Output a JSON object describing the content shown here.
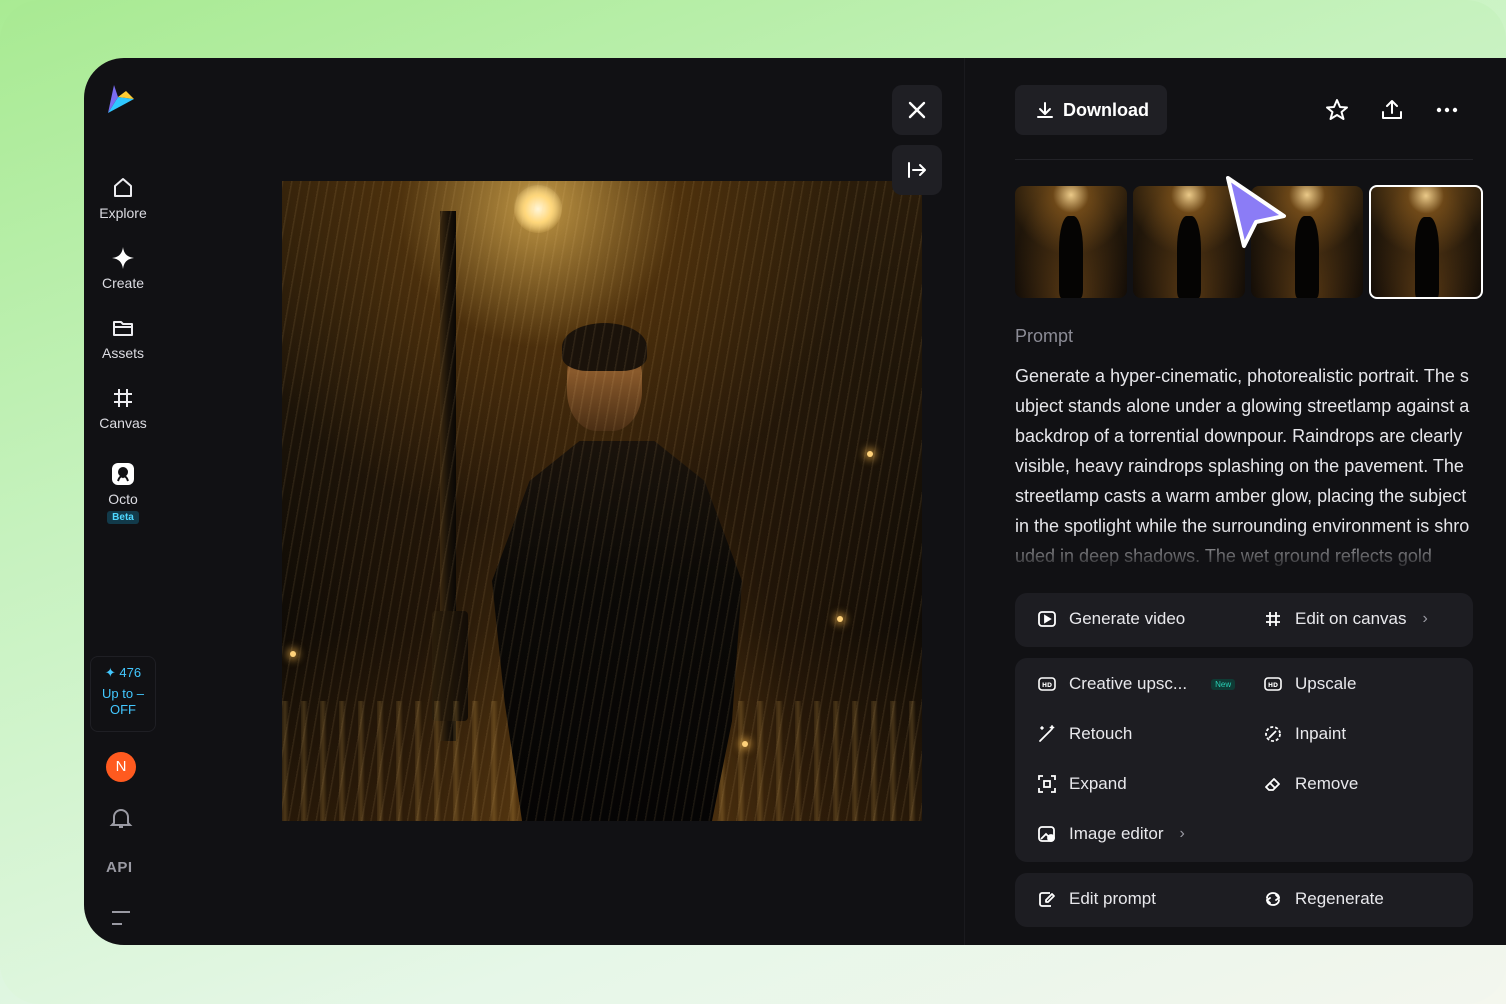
{
  "sidebar": {
    "items": [
      {
        "label": "Explore",
        "icon": "home-icon"
      },
      {
        "label": "Create",
        "icon": "sparkle-icon"
      },
      {
        "label": "Assets",
        "icon": "folder-icon"
      },
      {
        "label": "Canvas",
        "icon": "frame-icon"
      },
      {
        "label": "Octo",
        "icon": "octo-icon",
        "badge": "Beta"
      }
    ],
    "credits": {
      "count": "476",
      "promo_line1": "Up to –",
      "promo_line2": "OFF"
    },
    "avatar_letter": "N",
    "api_label": "API"
  },
  "toolbar": {
    "download_label": "Download"
  },
  "prompt": {
    "label": "Prompt",
    "text": "Generate a hyper-cinematic, photorealistic portrait. The subject stands alone under a glowing streetlamp against a backdrop of a torrential downpour. Raindrops are clearly visible, heavy raindrops splashing on the pavement. The streetlamp casts a warm amber glow, placing the subject in the spotlight while the surrounding environment is shrouded in deep shadows. The wet ground reflects gold"
  },
  "actions": {
    "group1": {
      "generate_video": "Generate video",
      "edit_on_canvas": "Edit on canvas"
    },
    "group2": {
      "creative_upscale": "Creative upsc...",
      "new_badge": "New",
      "upscale": "Upscale",
      "retouch": "Retouch",
      "inpaint": "Inpaint",
      "expand": "Expand",
      "remove": "Remove",
      "image_editor": "Image editor"
    },
    "group3": {
      "edit_prompt": "Edit prompt",
      "regenerate": "Regenerate"
    }
  },
  "thumbnails": {
    "selected_index": 3
  },
  "colors": {
    "accent": "#43c8ff",
    "cursor": "#8b7cf6",
    "avatar": "#ff5a1f"
  }
}
